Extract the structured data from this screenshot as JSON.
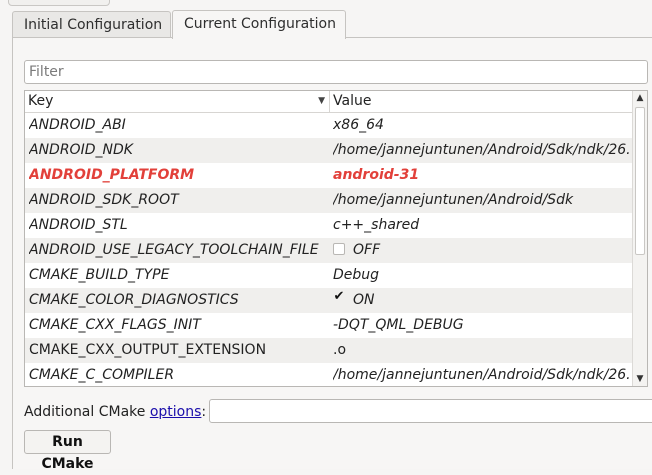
{
  "tabs": [
    {
      "label": "Initial Configuration",
      "active": false
    },
    {
      "label": "Current Configuration",
      "active": true
    }
  ],
  "filter": {
    "placeholder": "Filter",
    "value": ""
  },
  "table": {
    "columns": {
      "key": "Key",
      "value": "Value"
    },
    "rows": [
      {
        "key": "ANDROID_ABI",
        "value": "x86_64",
        "type": "text",
        "changed": false
      },
      {
        "key": "ANDROID_NDK",
        "value": "/home/jannejuntunen/Android/Sdk/ndk/26...",
        "type": "text",
        "changed": false
      },
      {
        "key": "ANDROID_PLATFORM",
        "value": "android-31",
        "type": "text",
        "changed": true
      },
      {
        "key": "ANDROID_SDK_ROOT",
        "value": "/home/jannejuntunen/Android/Sdk",
        "type": "text",
        "changed": false
      },
      {
        "key": "ANDROID_STL",
        "value": "c++_shared",
        "type": "text",
        "changed": false
      },
      {
        "key": "ANDROID_USE_LEGACY_TOOLCHAIN_FILE",
        "value": "OFF",
        "type": "bool",
        "checked": false,
        "changed": false
      },
      {
        "key": "CMAKE_BUILD_TYPE",
        "value": "Debug",
        "type": "text",
        "changed": false
      },
      {
        "key": "CMAKE_COLOR_DIAGNOSTICS",
        "value": "ON",
        "type": "bool",
        "checked": true,
        "changed": false
      },
      {
        "key": "CMAKE_CXX_FLAGS_INIT",
        "value": "-DQT_QML_DEBUG",
        "type": "text",
        "changed": false
      },
      {
        "key": "CMAKE_CXX_OUTPUT_EXTENSION",
        "value": ".o",
        "type": "text",
        "changed": false,
        "plain": true
      },
      {
        "key": "CMAKE_C_COMPILER",
        "value": "/home/jannejuntunen/Android/Sdk/ndk/26...",
        "type": "text",
        "changed": false
      }
    ]
  },
  "additional": {
    "label_prefix": "Additional CMake ",
    "link": "options",
    "label_suffix": ":",
    "value": ""
  },
  "run_button": {
    "label": "Run CMake"
  },
  "icons": {
    "sort": "sort-down-icon",
    "scroll_up": "arrow-up-icon",
    "scroll_down": "arrow-down-icon",
    "check": "checkmark-icon"
  },
  "colors": {
    "changed_text": "#e2403a",
    "link": "#1a0dab"
  }
}
